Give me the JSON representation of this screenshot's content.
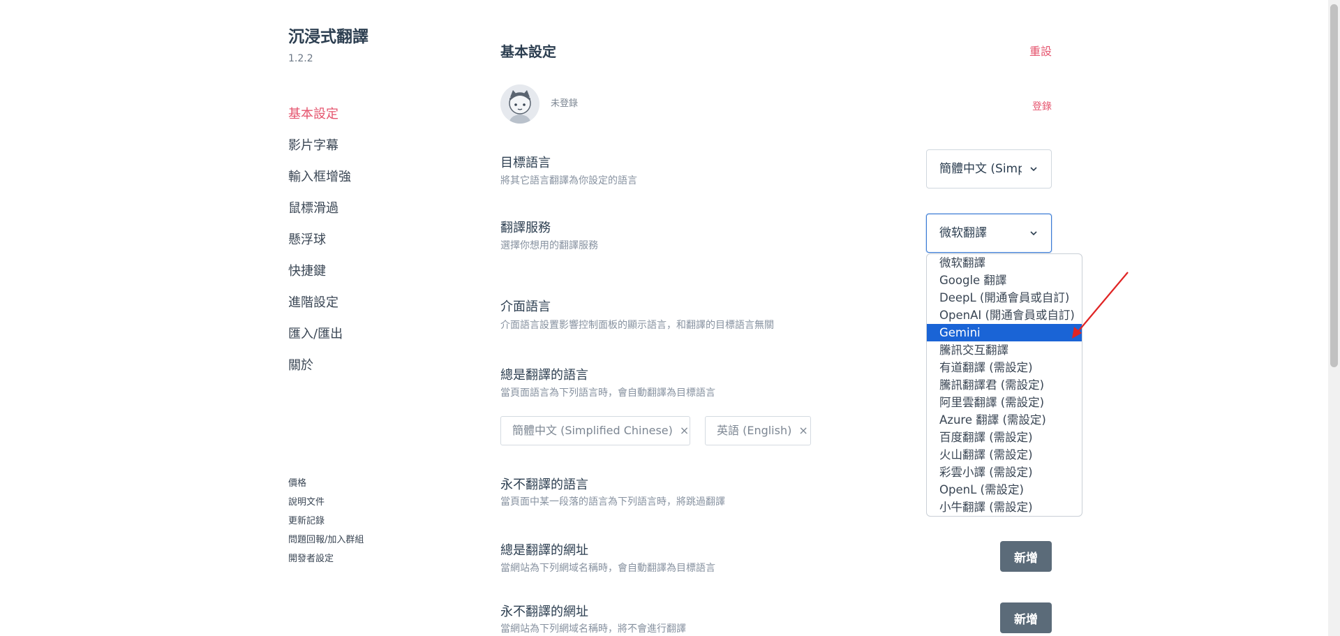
{
  "app": {
    "title": "沉浸式翻譯",
    "version": "1.2.2"
  },
  "sidebar": {
    "items": [
      {
        "label": "基本設定",
        "active": true
      },
      {
        "label": "影片字幕"
      },
      {
        "label": "輸入框增強"
      },
      {
        "label": "鼠標滑過"
      },
      {
        "label": "懸浮球"
      },
      {
        "label": "快捷鍵"
      },
      {
        "label": "進階設定"
      },
      {
        "label": "匯入/匯出"
      },
      {
        "label": "關於"
      }
    ],
    "footer_links": [
      {
        "label": "價格"
      },
      {
        "label": "說明文件"
      },
      {
        "label": "更新記錄"
      },
      {
        "label": "問題回報/加入群組"
      },
      {
        "label": "開發者設定"
      }
    ]
  },
  "main": {
    "title": "基本設定",
    "reset_label": "重設",
    "account": {
      "status": "未登錄",
      "login_label": "登錄"
    },
    "target_language": {
      "label": "目標語言",
      "desc": "將其它語言翻譯為你設定的語言",
      "value": "簡體中文 (Simplified Chinese)"
    },
    "translation_service": {
      "label": "翻譯服務",
      "desc": "選擇你想用的翻譯服務",
      "value": "微软翻譯",
      "options": [
        "微软翻譯",
        "Google 翻譯",
        "DeepL (開通會員或自訂)",
        "OpenAI (開通會員或自訂)",
        "Gemini",
        "騰訊交互翻譯",
        "有道翻譯 (需設定)",
        "騰訊翻譯君 (需設定)",
        "阿里雲翻譯 (需設定)",
        "Azure 翻譯 (需設定)",
        "百度翻譯 (需設定)",
        "火山翻譯 (需設定)",
        "彩雲小譯 (需設定)",
        "OpenL (需設定)",
        "小牛翻譯 (需設定)"
      ],
      "highlighted_option": "Gemini"
    },
    "ui_language": {
      "label": "介面語言",
      "desc": "介面語言設置影響控制面板的顯示語言，和翻譯的目標語言無關"
    },
    "always_translate_languages": {
      "label": "總是翻譯的語言",
      "desc": "當頁面語言為下列語言時，會自動翻譯為目標語言",
      "tags": [
        "簡體中文 (Simplified Chinese)",
        "英語 (English)"
      ],
      "remove_symbol": "×"
    },
    "never_translate_languages": {
      "label": "永不翻譯的語言",
      "desc": "當頁面中某一段落的語言為下列語言時，將跳過翻譯"
    },
    "always_translate_urls": {
      "label": "總是翻譯的網址",
      "desc": "當網站為下列網域名稱時，會自動翻譯為目標語言",
      "add_label": "新增"
    },
    "never_translate_urls": {
      "label": "永不翻譯的網址",
      "desc": "當網站為下列網域名稱時，將不會進行翻譯",
      "add_label": "新增"
    }
  },
  "colors": {
    "accent": "#e5546e",
    "selected_option": "#1a64d6",
    "button": "#5b6b79",
    "annotation_arrow": "#e02424"
  },
  "icons": {
    "select_arrow": "chevron-down-icon",
    "avatar": "avatar-icon",
    "tag_remove": "close-icon"
  }
}
